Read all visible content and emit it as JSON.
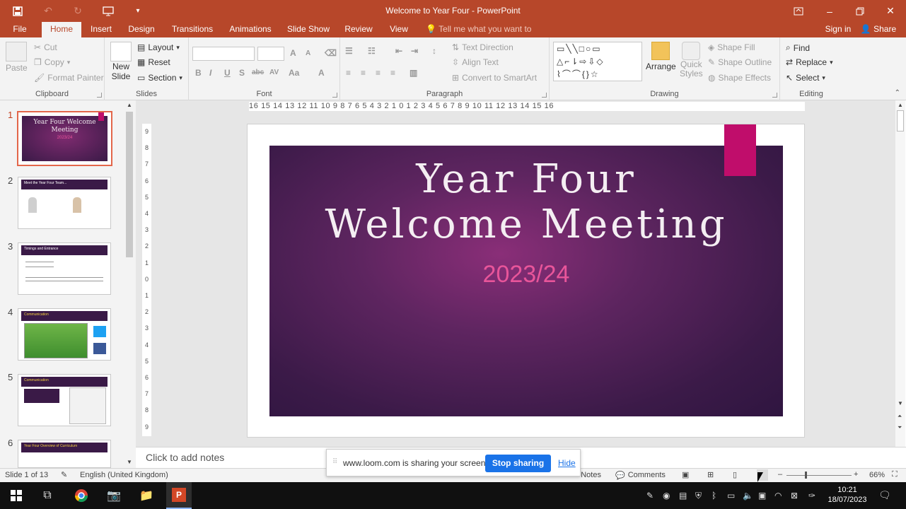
{
  "window": {
    "title": "Welcome to Year Four - PowerPoint"
  },
  "tabs": [
    "File",
    "Home",
    "Insert",
    "Design",
    "Transitions",
    "Animations",
    "Slide Show",
    "Review",
    "View"
  ],
  "tell_me": "Tell me what you want to do...",
  "account": {
    "sign_in": "Sign in",
    "share": "Share"
  },
  "clipboard": {
    "paste": "Paste",
    "cut": "Cut",
    "copy": "Copy",
    "format_painter": "Format Painter",
    "label": "Clipboard"
  },
  "slides_group": {
    "new_slide": "New",
    "new_slide2": "Slide",
    "layout": "Layout",
    "reset": "Reset",
    "section": "Section",
    "label": "Slides"
  },
  "font": {
    "label": "Font",
    "bold": "B",
    "italic": "I",
    "underline": "U",
    "shadow": "S",
    "strike": "abc",
    "spacing": "AV",
    "case": "Aa",
    "color": "A",
    "grow": "A",
    "shrink": "A"
  },
  "paragraph": {
    "label": "Paragraph",
    "text_direction": "Text Direction",
    "align_text": "Align Text",
    "convert": "Convert to SmartArt"
  },
  "drawing": {
    "label": "Drawing",
    "arrange": "Arrange",
    "quick": "Quick",
    "styles": "Styles",
    "shape_fill": "Shape Fill",
    "shape_outline": "Shape Outline",
    "shape_effects": "Shape Effects"
  },
  "editing": {
    "label": "Editing",
    "find": "Find",
    "replace": "Replace",
    "select": "Select"
  },
  "ruler": {
    "h": "16 15 14 13 12 11 10 9 8 7 6 5 4 3 2 1 0 1 2 3 4 5 6 7 8 9 10 11 12 13 14 15 16",
    "v": [
      "9",
      "8",
      "7",
      "6",
      "5",
      "4",
      "3",
      "2",
      "1",
      "0",
      "1",
      "2",
      "3",
      "4",
      "5",
      "6",
      "7",
      "8",
      "9"
    ]
  },
  "slide": {
    "title_line1": "Year Four",
    "title_line2": "Welcome Meeting",
    "subtitle": "2023/24"
  },
  "thumbnails": [
    {
      "num": "1",
      "title": "Year Four Welcome Meeting",
      "sub": "2023/24"
    },
    {
      "num": "2",
      "title": "Meet the Year Four Team..."
    },
    {
      "num": "3",
      "title": "Timings and Entrance"
    },
    {
      "num": "4",
      "title": "Communication"
    },
    {
      "num": "5",
      "title": "Communication"
    },
    {
      "num": "6",
      "title": "Year Four Overview of Curriculum"
    }
  ],
  "notes": {
    "placeholder": "Click to add notes"
  },
  "status": {
    "slide_count": "Slide 1 of 13",
    "language": "English (United Kingdom)",
    "notes": "Notes",
    "comments": "Comments",
    "zoom": "66%"
  },
  "loom": {
    "message": "www.loom.com is sharing your screen.",
    "stop": "Stop sharing",
    "hide": "Hide"
  },
  "taskbar": {
    "time": "10:21",
    "date": "18/07/2023"
  },
  "colors": {
    "accent": "#b7472a",
    "slide_tag": "#c00d6b",
    "stop_button": "#1a73e8"
  }
}
